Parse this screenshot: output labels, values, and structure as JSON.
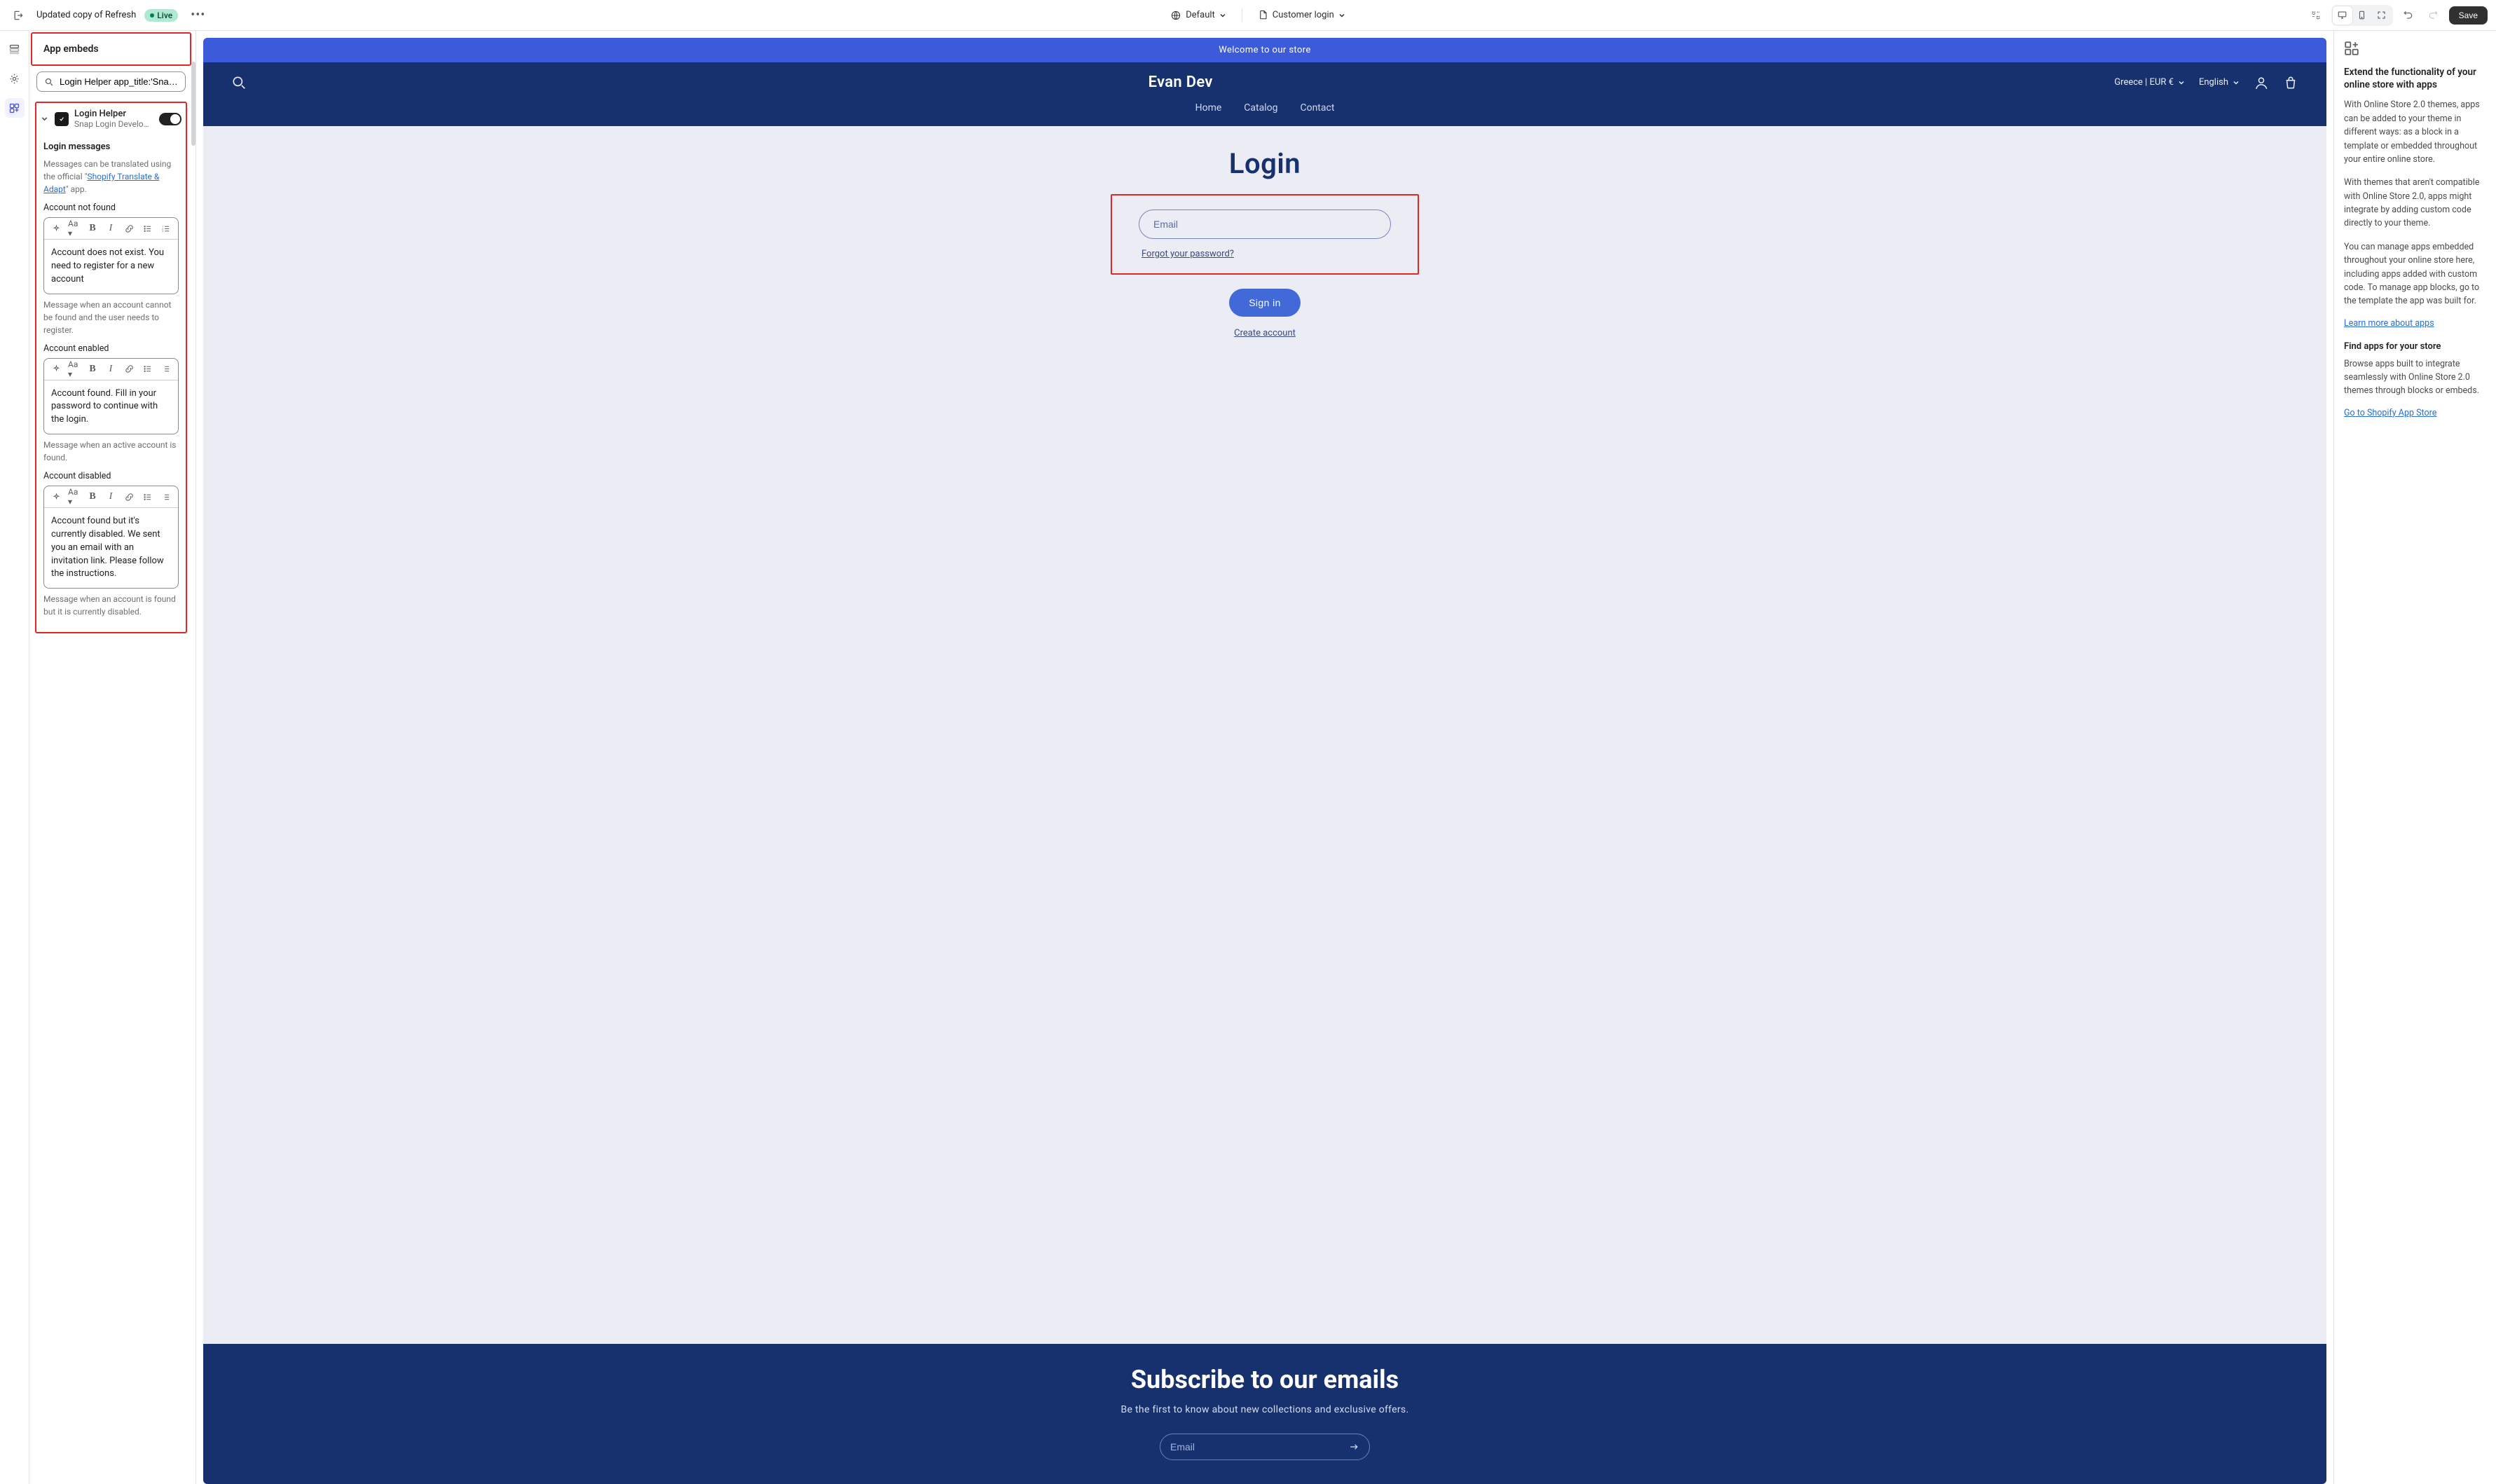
{
  "topbar": {
    "theme_name": "Updated copy of Refresh",
    "live_badge": "Live",
    "context_label": "Default",
    "template_label": "Customer login",
    "save_label": "Save"
  },
  "sidebar": {
    "header": "App embeds",
    "search_value": "Login Helper app_title:'Snap Lo",
    "embed": {
      "title": "Login Helper",
      "subtitle": "Snap Login Developm..."
    },
    "login_messages": {
      "heading": "Login messages",
      "help_pre": "Messages can be translated using the official \"",
      "help_link": "Shopify Translate & Adapt",
      "help_post": "\" app.",
      "account_not_found": {
        "label": "Account not found",
        "body": "Account does not exist. You need to register for a new account",
        "hint": "Message when an account cannot be found and the user needs to register."
      },
      "account_enabled": {
        "label": "Account enabled",
        "body": "Account found. Fill in your password to continue with the login.",
        "hint": "Message when an active account is found."
      },
      "account_disabled": {
        "label": "Account disabled",
        "body": "Account found but it's currently disabled. We sent you an email with an invitation link. Please follow the instructions.",
        "hint": "Message when an account is found but it is currently disabled."
      }
    }
  },
  "preview": {
    "announcement": "Welcome to our store",
    "store_name": "Evan Dev",
    "locale": "Greece | EUR €",
    "language": "English",
    "nav": {
      "home": "Home",
      "catalog": "Catalog",
      "contact": "Contact"
    },
    "login": {
      "title": "Login",
      "email_placeholder": "Email",
      "forgot": "Forgot your password?",
      "signin": "Sign in",
      "create": "Create account"
    },
    "subscribe": {
      "title": "Subscribe to our emails",
      "tagline": "Be the first to know about new collections and exclusive offers.",
      "email_placeholder": "Email"
    }
  },
  "right_panel": {
    "title": "Extend the functionality of your online store with apps",
    "p1": "With Online Store 2.0 themes, apps can be added to your theme in different ways: as a block in a template or embedded throughout your entire online store.",
    "p2": "With themes that aren't compatible with Online Store 2.0, apps might integrate by adding custom code directly to your theme.",
    "p3": "You can manage apps embedded throughout your online store here, including apps added with custom code. To manage app blocks, go to the template the app was built for.",
    "learn_link": "Learn more about apps",
    "find_title": "Find apps for your store",
    "find_p": "Browse apps built to integrate seamlessly with Online Store 2.0 themes through blocks or embeds.",
    "store_link": "Go to Shopify App Store"
  }
}
